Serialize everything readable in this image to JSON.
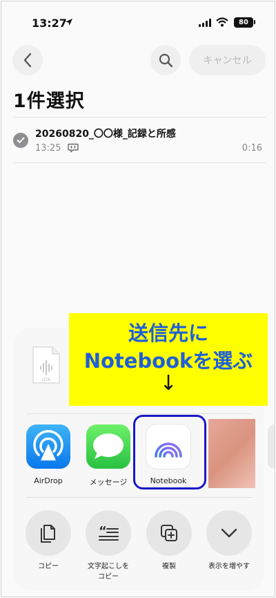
{
  "status": {
    "time": "13:27",
    "battery": "80"
  },
  "nav": {
    "cancel_label": "キャンセル"
  },
  "page": {
    "title": "1件選択"
  },
  "recording": {
    "title": "20260820_〇〇様_記録と所感",
    "time": "13:25",
    "duration": "0:16"
  },
  "file": {
    "label": "QTA"
  },
  "banner": {
    "line1": "送信先に",
    "line2": "Notebookを選ぶ",
    "arrow": "↓"
  },
  "apps": [
    {
      "label": "AirDrop"
    },
    {
      "label": "メッセージ"
    },
    {
      "label": "Notebook"
    }
  ],
  "actions": [
    {
      "label": "コピー"
    },
    {
      "label_line1": "文字起こしを",
      "label_line2": "コピー"
    },
    {
      "label": "複製"
    },
    {
      "label": "表示を増やす"
    }
  ]
}
